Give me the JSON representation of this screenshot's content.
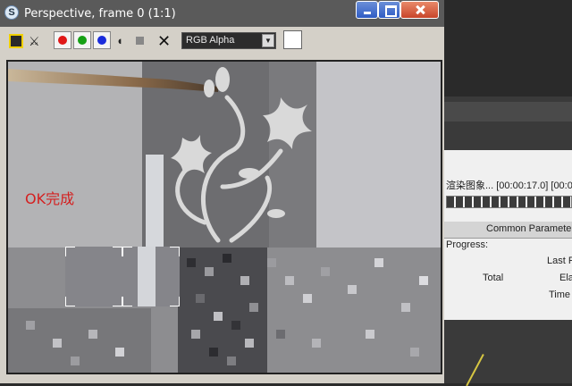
{
  "window": {
    "title": "Perspective, frame 0 (1:1)",
    "app_icon": "3ds-max-logo"
  },
  "toolbar": {
    "channel_select": "RGB Alpha",
    "icons": [
      "save-icon",
      "clone-window-icon",
      "red-channel-icon",
      "green-channel-icon",
      "blue-channel-icon",
      "alpha-channel-icon",
      "monochrome-icon",
      "clear-icon"
    ],
    "swatch_color": "#ffffff"
  },
  "render": {
    "status_text": "OK完成",
    "status_color": "#d42020"
  },
  "background_panel": {
    "render_label": "渲染图象... [00:00:17.0] [00:0",
    "common_parameters": "Common Parameters",
    "progress_label": "Progress:",
    "total_label": "Total",
    "last_label": "Last F",
    "elapsed_label": "Ela",
    "time_label": "Time"
  }
}
